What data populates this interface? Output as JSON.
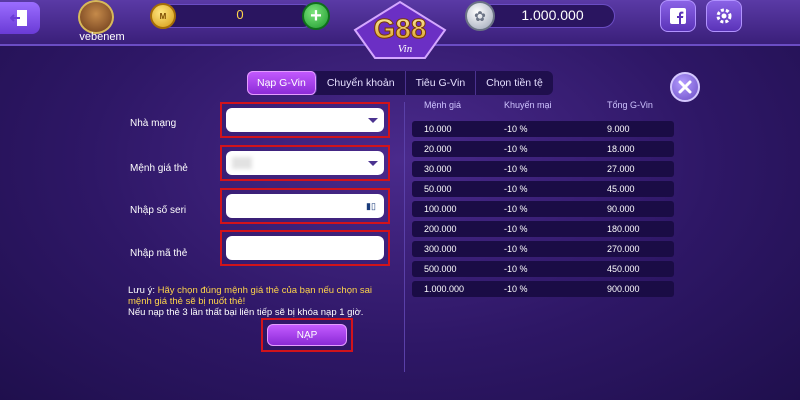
{
  "header": {
    "username": "vebenem",
    "coin_value": "0",
    "coin_badge": "M",
    "silver_value": "1.000.000",
    "logo_text": "G88",
    "logo_sub": "Vin"
  },
  "tabs": [
    {
      "label": "Nạp G-Vin",
      "active": true
    },
    {
      "label": "Chuyển khoản",
      "active": false
    },
    {
      "label": "Tiêu G-Vin",
      "active": false
    },
    {
      "label": "Chọn tiền tệ",
      "active": false
    }
  ],
  "form": {
    "carrier_label": "Nhà mạng",
    "carrier_value": "",
    "denomination_label": "Mệnh giá thẻ",
    "serial_label": "Nhập số seri",
    "serial_value": "",
    "code_label": "Nhập mã thẻ",
    "code_value": "",
    "note_prefix": "Lưu ý: ",
    "note_warning": "Hãy chọn đúng mệnh giá thẻ của bạn nếu chọn sai mệnh giá thẻ sẽ bị nuốt thẻ!",
    "note_info": "Nếu nạp thẻ 3 lần thất bại liên tiếp sẽ bị khóa nạp 1 giờ.",
    "submit_label": "NẠP"
  },
  "table": {
    "headers": [
      "Mệnh giá",
      "Khuyến mại",
      "Tổng G-Vin"
    ],
    "rows": [
      [
        "10.000",
        "-10 %",
        "9.000"
      ],
      [
        "20.000",
        "-10 %",
        "18.000"
      ],
      [
        "30.000",
        "-10 %",
        "27.000"
      ],
      [
        "50.000",
        "-10 %",
        "45.000"
      ],
      [
        "100.000",
        "-10 %",
        "90.000"
      ],
      [
        "200.000",
        "-10 %",
        "180.000"
      ],
      [
        "300.000",
        "-10 %",
        "270.000"
      ],
      [
        "500.000",
        "-10 %",
        "450.000"
      ],
      [
        "1.000.000",
        "-10 %",
        "900.000"
      ]
    ]
  },
  "icons": {
    "exit": "exit-icon",
    "coin": "gold-coin-icon",
    "plus": "plus-icon",
    "silver": "silver-coin-icon",
    "facebook": "facebook-icon",
    "settings": "gear-icon",
    "close": "close-icon",
    "dropdown": "chevron-down-icon",
    "captcha": "captcha-icon"
  },
  "colors": {
    "highlight": "#d1131b",
    "accent": "#8a2ad6",
    "coin_text": "#ffd54a"
  }
}
